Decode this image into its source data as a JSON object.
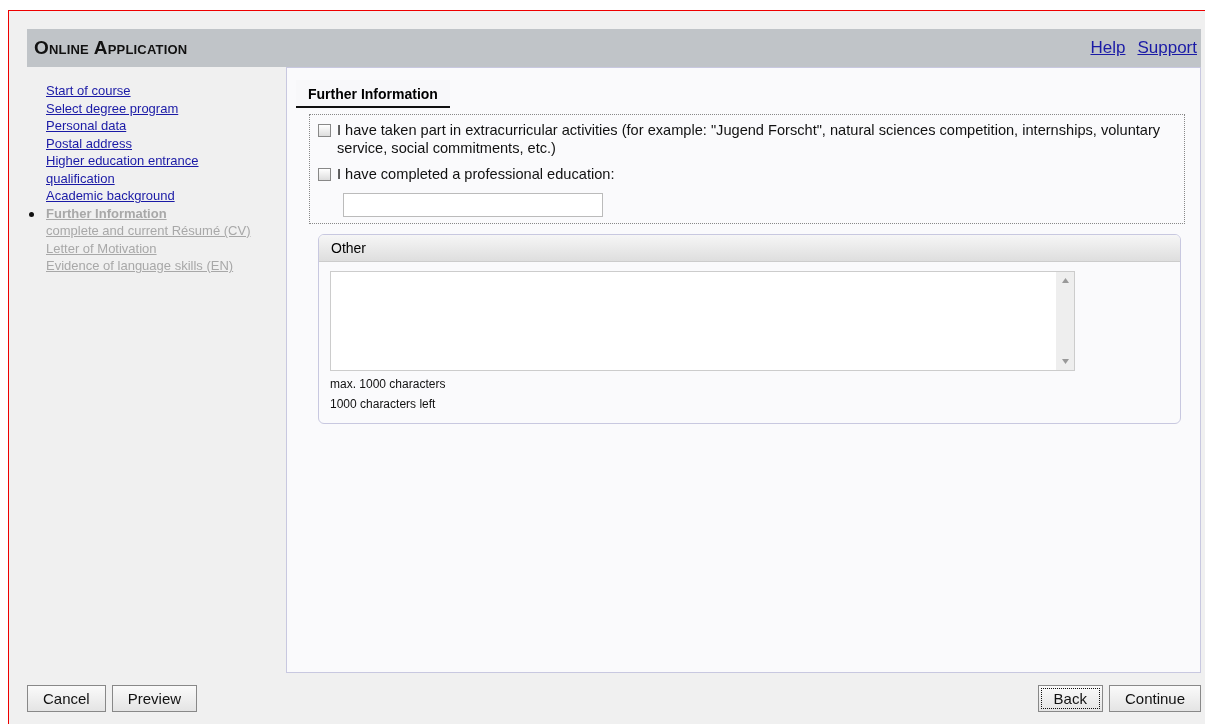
{
  "header": {
    "title": "Online Application",
    "links": [
      "Help",
      "Support"
    ]
  },
  "sidebar": {
    "items": [
      {
        "label": "Start of course",
        "selected": false,
        "disabled": false
      },
      {
        "label": "Select degree program",
        "selected": false,
        "disabled": false
      },
      {
        "label": "Personal data",
        "selected": false,
        "disabled": false
      },
      {
        "label": "Postal address",
        "selected": false,
        "disabled": false
      },
      {
        "label": "Higher education entrance qualification",
        "selected": false,
        "disabled": false
      },
      {
        "label": "Academic background",
        "selected": false,
        "disabled": false
      },
      {
        "label": "Further Information",
        "selected": true,
        "disabled": true
      },
      {
        "label": "complete and current Résumé (CV)",
        "selected": false,
        "disabled": true
      },
      {
        "label": "Letter of Motivation",
        "selected": false,
        "disabled": true
      },
      {
        "label": "Evidence of language skills (EN)",
        "selected": false,
        "disabled": true
      }
    ]
  },
  "section": {
    "title": "Further Information",
    "options": [
      {
        "label": "I have taken part in extracurricular activities (for example: \"Jugend Forscht\", natural sciences competition, internships, voluntary service, social commitments, etc.)",
        "checked": false
      },
      {
        "label": "I have completed a professional education:",
        "checked": false,
        "has_field": true
      }
    ]
  },
  "other": {
    "title": "Other",
    "hints": [
      "max. 1000 characters",
      "1000 characters left"
    ]
  },
  "footer": {
    "left_buttons": [
      {
        "label": "Cancel",
        "focused": false
      },
      {
        "label": "Preview",
        "focused": false
      }
    ],
    "right_buttons": [
      {
        "label": "Back",
        "focused": true
      },
      {
        "label": "Continue",
        "focused": false
      }
    ]
  }
}
